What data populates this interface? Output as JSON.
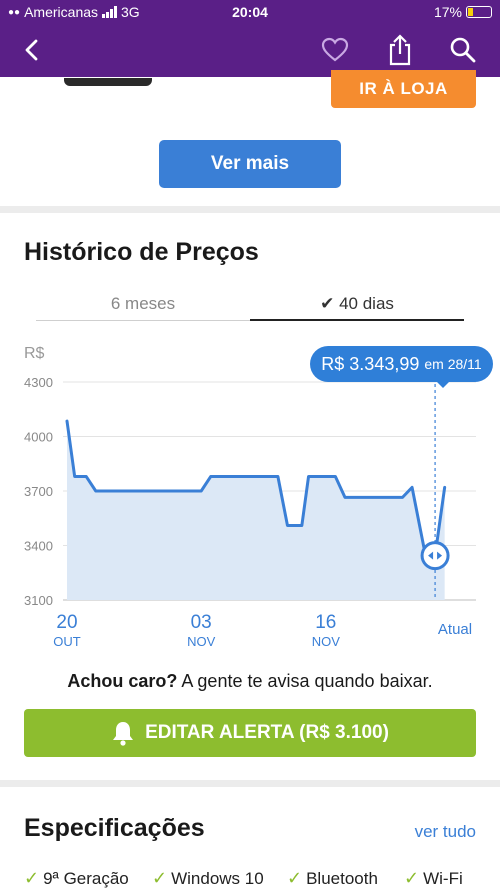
{
  "status_bar": {
    "carrier": "Americanas",
    "network": "3G",
    "time": "20:04",
    "battery": "17%"
  },
  "nav": {
    "back_icon": "chevron-left-icon",
    "fav_icon": "heart-icon",
    "share_icon": "share-icon",
    "search_icon": "search-icon"
  },
  "store": {
    "goto_label": "IR À LOJA",
    "see_more_label": "Ver mais"
  },
  "history": {
    "title": "Histórico de Preços",
    "tabs": [
      {
        "label": "6 meses",
        "active": false
      },
      {
        "label": "40 dias",
        "active": true
      }
    ],
    "tooltip": {
      "value": "R$ 3.343,99",
      "date": "em 28/11"
    },
    "alert_prompt_bold": "Achou caro?",
    "alert_prompt": "A gente te avisa quando baixar.",
    "alert_button": "EDITAR ALERTA (R$ 3.100)"
  },
  "chart_data": {
    "type": "area",
    "ylabel": "R$",
    "ylim": [
      3100,
      4300
    ],
    "yticks": [
      4300,
      4000,
      3700,
      3400,
      3100
    ],
    "xticks": [
      {
        "day": "20",
        "month": "OUT",
        "pos": 0
      },
      {
        "day": "03",
        "month": "NOV",
        "pos": 14
      },
      {
        "day": "16",
        "month": "NOV",
        "pos": 27
      },
      {
        "day": "Atual",
        "month": "",
        "pos": 39
      }
    ],
    "series": [
      {
        "x": [
          0,
          0.8,
          2,
          3,
          14,
          15,
          22,
          23,
          24.5,
          25.2,
          28,
          29,
          35,
          36,
          37.4,
          38.4,
          39.4
        ],
        "values": [
          4085,
          3780,
          3780,
          3700,
          3700,
          3780,
          3780,
          3510,
          3510,
          3780,
          3780,
          3665,
          3665,
          3720,
          3345,
          3345,
          3720
        ]
      }
    ],
    "marker": {
      "x": 38.4,
      "value": 3343.99
    },
    "line_color": "#3a7fd6",
    "fill_color": "#dce8f6"
  },
  "specs": {
    "title": "Especificações",
    "see_all": "ver tudo",
    "items": [
      "9ª Geração",
      "Windows 10",
      "Bluetooth",
      "Wi-Fi"
    ]
  }
}
